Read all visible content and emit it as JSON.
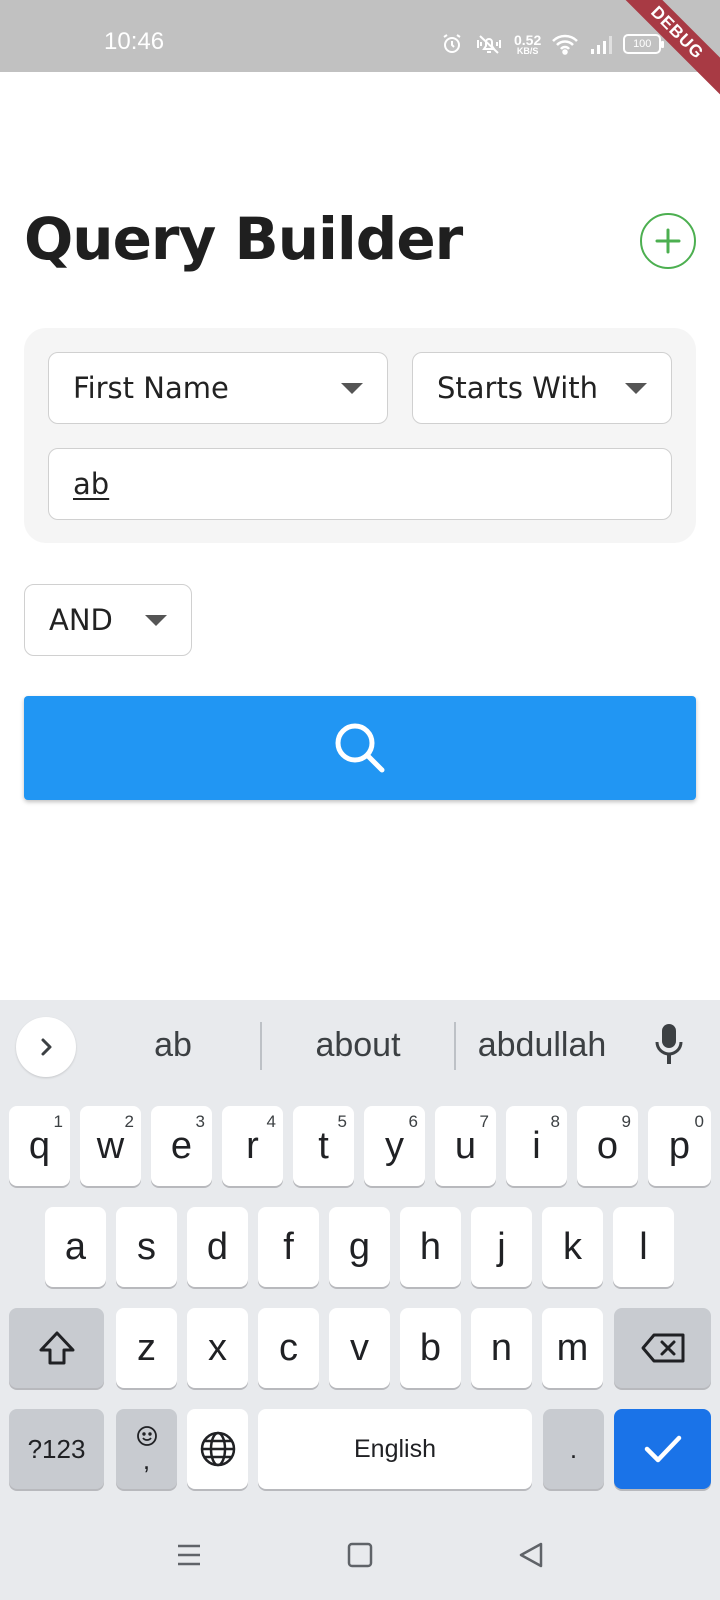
{
  "status_bar": {
    "time": "10:46",
    "net_speed_value": "0.52",
    "net_speed_unit": "KB/S",
    "battery": "100",
    "icons": [
      "alarm-icon",
      "vibrate-icon",
      "wifi-icon",
      "signal-icon",
      "battery-icon"
    ]
  },
  "debug_banner": "DEBUG",
  "header": {
    "title": "Query Builder",
    "add_icon": "plus-icon",
    "accent_color": "#4caf50"
  },
  "condition": {
    "field": "First Name",
    "operator": "Starts With",
    "value": "ab"
  },
  "logic": "AND",
  "search": {
    "icon": "search-icon",
    "color": "#2196f3"
  },
  "keyboard": {
    "suggestions": [
      "ab",
      "about",
      "abdullah"
    ],
    "row1": [
      {
        "key": "q",
        "hint": "1"
      },
      {
        "key": "w",
        "hint": "2"
      },
      {
        "key": "e",
        "hint": "3"
      },
      {
        "key": "r",
        "hint": "4"
      },
      {
        "key": "t",
        "hint": "5"
      },
      {
        "key": "y",
        "hint": "6"
      },
      {
        "key": "u",
        "hint": "7"
      },
      {
        "key": "i",
        "hint": "8"
      },
      {
        "key": "o",
        "hint": "9"
      },
      {
        "key": "p",
        "hint": "0"
      }
    ],
    "row2": [
      "a",
      "s",
      "d",
      "f",
      "g",
      "h",
      "j",
      "k",
      "l"
    ],
    "row3": [
      "z",
      "x",
      "c",
      "v",
      "b",
      "n",
      "m"
    ],
    "symbols_key": "?123",
    "comma_key": ",",
    "space_label": "English",
    "period_key": ".",
    "enter_color": "#1a73e8"
  }
}
